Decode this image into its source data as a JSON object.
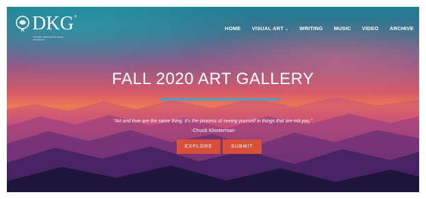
{
  "logo": {
    "text": "DKG",
    "registered": "®",
    "subtitle": "The Delta Kappa Gamma Society International"
  },
  "nav": {
    "items": [
      {
        "label": "HOME"
      },
      {
        "label": "VISUAL ART",
        "caret": "⌄"
      },
      {
        "label": "WRITING"
      },
      {
        "label": "MUSIC"
      },
      {
        "label": "VIDEO"
      },
      {
        "label": "ARCHIVE"
      }
    ]
  },
  "hero": {
    "title": "FALL 2020 ART GALLERY",
    "quote": "\"Art and love are the same thing: It's the process of seeing yourself in things that are not you.\"",
    "author": "-Chuck Klosterman",
    "explore_label": "EXPLORE",
    "submit_label": "SUBMIT"
  },
  "colors": {
    "accent_line": "#3aa6d6",
    "button": "#d9503a"
  }
}
